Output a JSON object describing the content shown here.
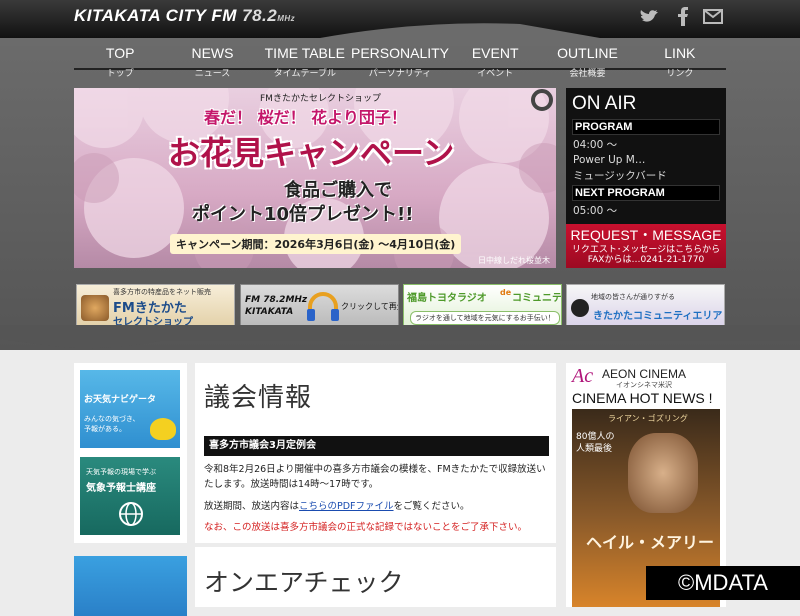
{
  "header": {
    "logo_text": "KITAKATA CITY FM",
    "logo_freq": "78.2",
    "logo_unit": "MHz"
  },
  "social": [
    {
      "icon": "twitter-icon"
    },
    {
      "icon": "facebook-icon"
    },
    {
      "icon": "mail-icon"
    }
  ],
  "nav": [
    {
      "en": "TOP",
      "ja": "トップ"
    },
    {
      "en": "NEWS",
      "ja": "ニュース"
    },
    {
      "en": "TIME TABLE",
      "ja": "タイムテーブル"
    },
    {
      "en": "PERSONALITY",
      "ja": "パーソナリティ"
    },
    {
      "en": "EVENT",
      "ja": "イベント"
    },
    {
      "en": "OUTLINE",
      "ja": "会社概要"
    },
    {
      "en": "LINK",
      "ja": "リンク"
    }
  ],
  "banner": {
    "top_label": "FMきたかたセレクトショップ",
    "headline1": "春だ！ 桜だ！ 花より団子！",
    "headline2": "お花見キャンペーン",
    "sub1": "食品ご購入で",
    "sub2": "ポイント10倍プレゼント!!",
    "period": "キャンペーン期間：2026年3月6日(金) ～4月10日(金)",
    "credit": "日中線しだれ桜並木"
  },
  "onair": {
    "title": "ON AIR",
    "program_label": "PROGRAM",
    "program_time": "04:00 ～",
    "program_name1": "Power Up M…",
    "program_name2": "ミュージックバード",
    "next_label": "NEXT PROGRAM",
    "next_time": "05:00 ～"
  },
  "request": {
    "title": "REQUEST・MESSAGE",
    "line1": "リクエスト･メッセージはこちらから",
    "line2": "FAXからは…0241-21-1770"
  },
  "mini_banners": [
    {
      "small": "喜多方市の特産品をネット販売",
      "main": "FMきたかた",
      "main2": "セレクトショップ"
    },
    {
      "logo": "FM 78.2MHz",
      "logo2": "KITAKATA",
      "text": "クリックして再生"
    },
    {
      "main": "福島トヨタラジオ",
      "mid": "de",
      "main2": "コミュニティ",
      "sub": "ラジオを通して地域を元気にするお手伝い！"
    },
    {
      "small": "地域の皆さんが通りすがる",
      "main": "きたかたコミュニティエリア"
    }
  ],
  "left_banners": [
    {
      "title": "お天気ナビゲータ",
      "sub1": "みんなの気づき、",
      "sub2": "予報がある。"
    },
    {
      "small": "天気予報の現場で学ぶ",
      "title": "気象予報士講座"
    }
  ],
  "article": {
    "title": "議会情報",
    "bar": "喜多方市議会3月定例会",
    "p1": "令和8年2月26日より開催中の喜多方市議会の模様を、FMきたかたで収録放送いたします。放送時間は14時～17時です。",
    "p2_before": "放送期間、放送内容は",
    "p2_link": "こちらのPDFファイル",
    "p2_after": "をご覧ください。",
    "p3": "なお、この放送は喜多方市議会の正式な記録ではないことをご了承下さい。",
    "p3_color": "#d42020"
  },
  "article2": {
    "title": "オンエアチェック"
  },
  "cinema": {
    "logo_mark": "Ac",
    "brand": "AEON CINEMA",
    "brand_sub": "イオンシネマ米沢",
    "hot": "CINEMA HOT NEWS !",
    "poster_top": "ライアン・ゴズリング",
    "poster_side": "80億人の人類最後",
    "poster_title": "ヘイル・メアリー"
  },
  "watermark": "©MDATA",
  "colors": {
    "accent_red": "#c8102e",
    "link_blue": "#1a4cb0"
  }
}
